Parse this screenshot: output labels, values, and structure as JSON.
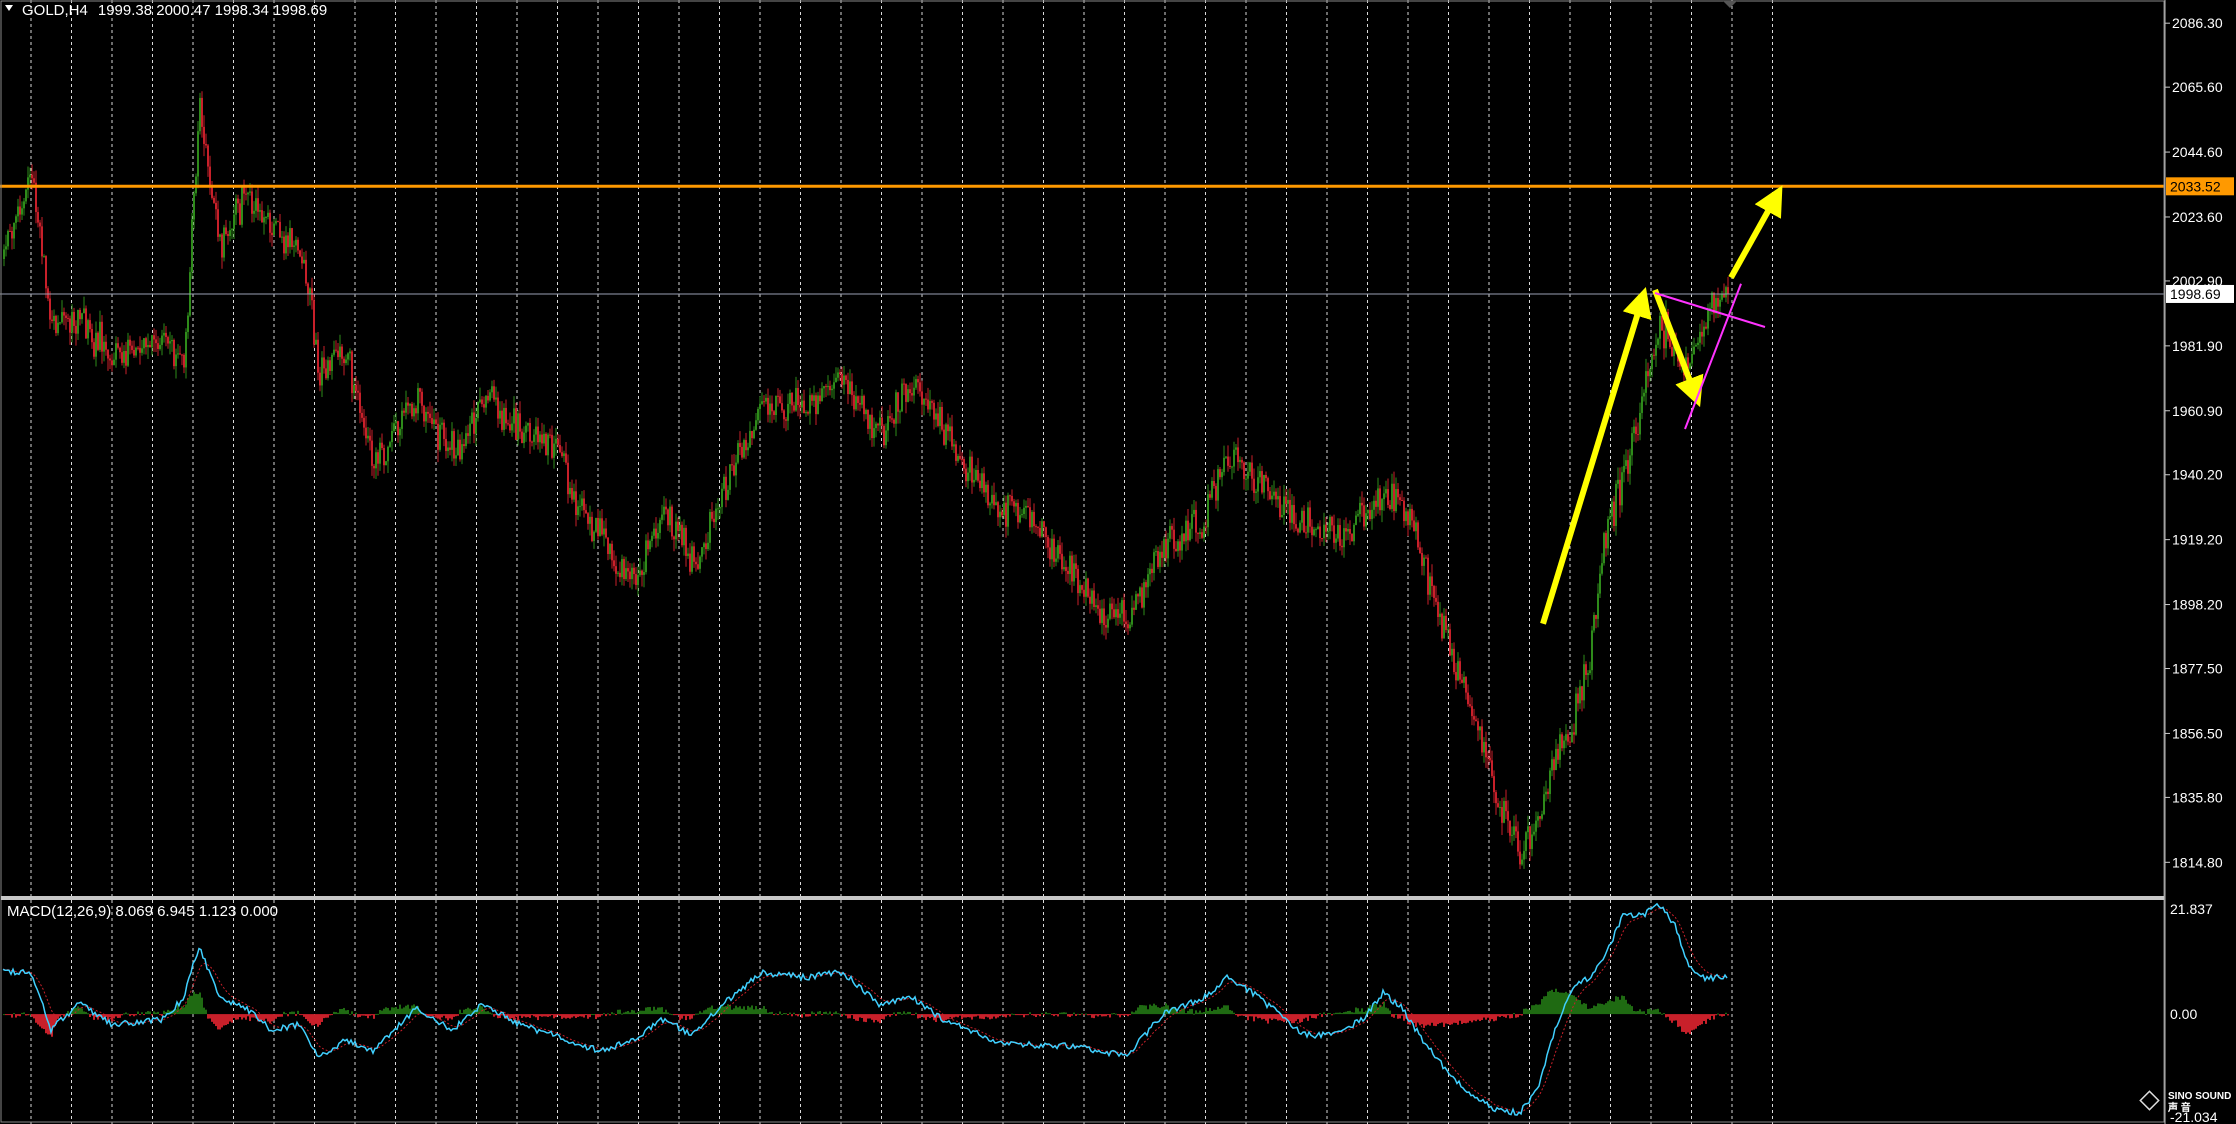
{
  "window": {
    "title": "GOLD,H4",
    "ohlc": "1999.38 2000.47 1998.34 1998.69"
  },
  "price_axis": {
    "ticks": [
      "2086.30",
      "2065.60",
      "2044.60",
      "2023.60",
      "2002.90",
      "1981.90",
      "1960.90",
      "1940.20",
      "1919.20",
      "1898.20",
      "1877.50",
      "1856.50",
      "1835.80",
      "1814.80"
    ],
    "resistance_label": "2033.52",
    "bid_label": "1998.69"
  },
  "macd": {
    "title": "MACD(12,26,9) 8.069 6.945 1.123 0.000",
    "ticks": [
      "21.837",
      "0.00",
      "-21.034"
    ]
  },
  "watermark": {
    "line1": "SINO SOUND",
    "line2": "声 音"
  },
  "colors": {
    "background": "#000000",
    "bull_candle": "#2e8b1a",
    "bear_candle": "#c8202a",
    "resistance": "#ff9900",
    "bid_line": "#9aa0b4",
    "grid": "#ffffff",
    "macd_signal": "#40d0ff",
    "arrows": "#ffff00",
    "pattern_lines": "#ff33ff"
  },
  "chart_data": {
    "type": "candlestick",
    "symbol": "GOLD",
    "timeframe": "H4",
    "price_ylim": [
      1803.9,
      2093.8
    ],
    "resistance_level": 2033.52,
    "bid_price": 1998.69,
    "close_anchors": [
      [
        0,
        2010
      ],
      [
        14,
        2040
      ],
      [
        24,
        1988
      ],
      [
        38,
        1990
      ],
      [
        55,
        1978
      ],
      [
        80,
        1985
      ],
      [
        90,
        1975
      ],
      [
        98,
        2060
      ],
      [
        108,
        2015
      ],
      [
        122,
        2030
      ],
      [
        134,
        2020
      ],
      [
        148,
        2015
      ],
      [
        158,
        1975
      ],
      [
        172,
        1978
      ],
      [
        185,
        1945
      ],
      [
        206,
        1965
      ],
      [
        225,
        1948
      ],
      [
        240,
        1965
      ],
      [
        258,
        1955
      ],
      [
        275,
        1950
      ],
      [
        286,
        1932
      ],
      [
        300,
        1920
      ],
      [
        315,
        1905
      ],
      [
        330,
        1930
      ],
      [
        345,
        1910
      ],
      [
        360,
        1935
      ],
      [
        380,
        1962
      ],
      [
        400,
        1962
      ],
      [
        420,
        1972
      ],
      [
        438,
        1953
      ],
      [
        455,
        1972
      ],
      [
        470,
        1955
      ],
      [
        495,
        1930
      ],
      [
        515,
        1925
      ],
      [
        530,
        1912
      ],
      [
        548,
        1897
      ],
      [
        562,
        1893
      ],
      [
        580,
        1918
      ],
      [
        600,
        1925
      ],
      [
        612,
        1946
      ],
      [
        625,
        1940
      ],
      [
        638,
        1930
      ],
      [
        650,
        1925
      ],
      [
        665,
        1920
      ],
      [
        680,
        1925
      ],
      [
        690,
        1935
      ],
      [
        700,
        1930
      ],
      [
        708,
        1915
      ],
      [
        718,
        1893
      ],
      [
        730,
        1870
      ],
      [
        745,
        1838
      ],
      [
        758,
        1818
      ],
      [
        768,
        1828
      ],
      [
        775,
        1848
      ],
      [
        785,
        1862
      ],
      [
        793,
        1880
      ],
      [
        800,
        1920
      ],
      [
        810,
        1940
      ],
      [
        820,
        1968
      ],
      [
        828,
        1990
      ],
      [
        836,
        1980
      ],
      [
        842,
        1972
      ],
      [
        848,
        1985
      ],
      [
        855,
        1998
      ],
      [
        862,
        1999
      ]
    ],
    "macd": {
      "ylim": [
        -21.034,
        21.837
      ],
      "params": "12,26,9",
      "values": [
        8.069,
        6.945,
        1.123,
        0.0
      ],
      "macd_anchors": [
        [
          0,
          8
        ],
        [
          14,
          8
        ],
        [
          24,
          -3
        ],
        [
          38,
          2
        ],
        [
          55,
          -2
        ],
        [
          80,
          -1
        ],
        [
          90,
          3
        ],
        [
          98,
          13
        ],
        [
          108,
          3
        ],
        [
          122,
          1
        ],
        [
          134,
          -3
        ],
        [
          148,
          -2
        ],
        [
          158,
          -8
        ],
        [
          172,
          -5
        ],
        [
          185,
          -7
        ],
        [
          206,
          1
        ],
        [
          225,
          -3
        ],
        [
          240,
          2
        ],
        [
          258,
          -2
        ],
        [
          275,
          -4
        ],
        [
          286,
          -6
        ],
        [
          300,
          -7
        ],
        [
          315,
          -5
        ],
        [
          330,
          -1
        ],
        [
          345,
          -4
        ],
        [
          360,
          2
        ],
        [
          380,
          8
        ],
        [
          400,
          7
        ],
        [
          420,
          8
        ],
        [
          438,
          2
        ],
        [
          455,
          3
        ],
        [
          470,
          -1
        ],
        [
          495,
          -5
        ],
        [
          515,
          -6
        ],
        [
          530,
          -6
        ],
        [
          548,
          -7
        ],
        [
          562,
          -8
        ],
        [
          580,
          0
        ],
        [
          600,
          3
        ],
        [
          612,
          7
        ],
        [
          625,
          4
        ],
        [
          638,
          0
        ],
        [
          650,
          -4
        ],
        [
          665,
          -4
        ],
        [
          680,
          -1
        ],
        [
          690,
          4
        ],
        [
          700,
          1
        ],
        [
          708,
          -4
        ],
        [
          718,
          -9
        ],
        [
          730,
          -14
        ],
        [
          745,
          -18
        ],
        [
          758,
          -19
        ],
        [
          768,
          -14
        ],
        [
          775,
          -4
        ],
        [
          785,
          5
        ],
        [
          793,
          7
        ],
        [
          800,
          10
        ],
        [
          810,
          19
        ],
        [
          820,
          19
        ],
        [
          828,
          21
        ],
        [
          836,
          17
        ],
        [
          842,
          10
        ],
        [
          848,
          7
        ],
        [
          855,
          7
        ],
        [
          862,
          6.9
        ]
      ]
    },
    "annotations": [
      {
        "type": "arrow",
        "color": "yellow",
        "from": [
          770,
          1892
        ],
        "to": [
          821,
          2000
        ]
      },
      {
        "type": "arrow",
        "color": "yellow",
        "from": [
          826,
          2000
        ],
        "to": [
          848,
          1963
        ]
      },
      {
        "type": "arrow",
        "color": "yellow",
        "from": [
          864,
          2004
        ],
        "to": [
          889,
          2033
        ]
      },
      {
        "type": "line",
        "color": "magenta",
        "from": [
          826,
          1999
        ],
        "to": [
          881,
          1988
        ]
      },
      {
        "type": "line",
        "color": "magenta",
        "from": [
          841,
          1955
        ],
        "to": [
          869,
          2002
        ]
      }
    ]
  }
}
